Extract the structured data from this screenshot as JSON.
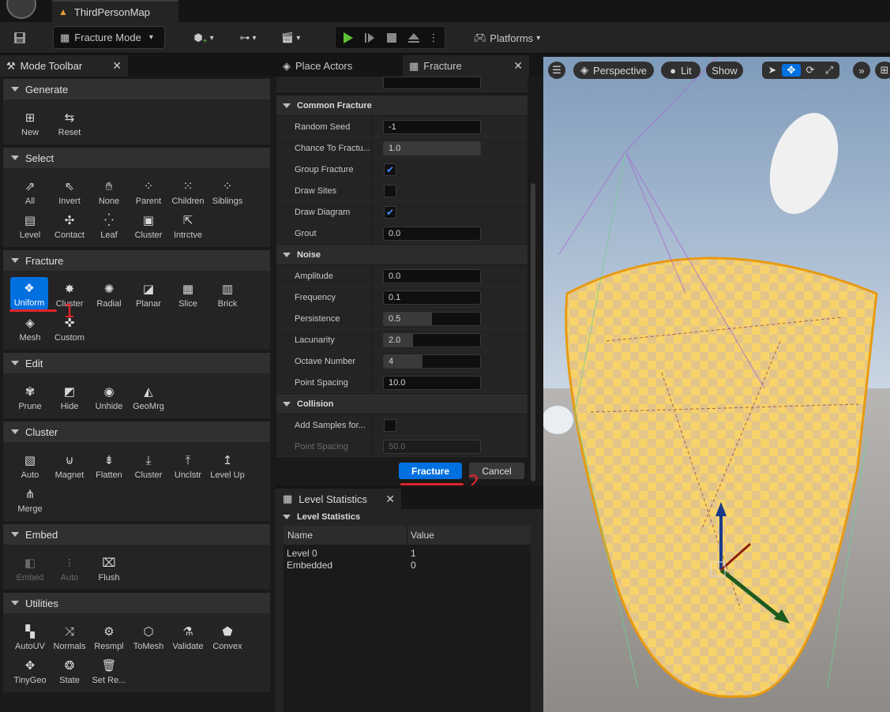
{
  "window": {
    "doc_tab": "ThirdPersonMap"
  },
  "toolbar": {
    "mode": "Fracture Mode",
    "platforms": "Platforms"
  },
  "mode_toolbar": {
    "tab": "Mode Toolbar",
    "sections": {
      "generate": {
        "title": "Generate",
        "tools": [
          "New",
          "Reset"
        ]
      },
      "select": {
        "title": "Select",
        "tools": [
          "All",
          "Invert",
          "None",
          "Parent",
          "Children",
          "Siblings",
          "Level",
          "Contact",
          "Leaf",
          "Cluster",
          "Intrctve"
        ]
      },
      "fracture": {
        "title": "Fracture",
        "tools": [
          "Uniform",
          "Cluster",
          "Radial",
          "Planar",
          "Slice",
          "Brick",
          "Mesh",
          "Custom"
        ]
      },
      "edit": {
        "title": "Edit",
        "tools": [
          "Prune",
          "Hide",
          "Unhide",
          "GeoMrg"
        ]
      },
      "cluster": {
        "title": "Cluster",
        "tools": [
          "Auto",
          "Magnet",
          "Flatten",
          "Cluster",
          "Unclstr",
          "Level Up",
          "Merge"
        ]
      },
      "embed": {
        "title": "Embed",
        "tools": [
          "Embed",
          "Auto",
          "Flush"
        ]
      },
      "utilities": {
        "title": "Utilities",
        "tools": [
          "AutoUV",
          "Normals",
          "Resmpl",
          "ToMesh",
          "Validate",
          "Convex",
          "TinyGeo",
          "State",
          "Set Re..."
        ]
      }
    }
  },
  "fracture_panel": {
    "tabs": [
      "Place Actors",
      "Fracture"
    ],
    "common_fracture": {
      "title": "Common Fracture",
      "random_seed": {
        "label": "Random Seed",
        "value": "-1"
      },
      "chance": {
        "label": "Chance To Fractu...",
        "value": "1.0",
        "level": 1.0
      },
      "group_fracture": {
        "label": "Group Fracture",
        "checked": true
      },
      "draw_sites": {
        "label": "Draw Sites",
        "checked": false
      },
      "draw_diagram": {
        "label": "Draw Diagram",
        "checked": true
      },
      "grout": {
        "label": "Grout",
        "value": "0.0"
      }
    },
    "noise": {
      "title": "Noise",
      "amplitude": {
        "label": "Amplitude",
        "value": "0.0"
      },
      "frequency": {
        "label": "Frequency",
        "value": "0.1"
      },
      "persistence": {
        "label": "Persistence",
        "value": "0.5",
        "level": 0.5
      },
      "lacunarity": {
        "label": "Lacunarity",
        "value": "2.0",
        "level": 0.3
      },
      "octave": {
        "label": "Octave Number",
        "value": "4",
        "level": 0.4
      },
      "point_spacing": {
        "label": "Point Spacing",
        "value": "10.0"
      }
    },
    "collision": {
      "title": "Collision",
      "add_samples": {
        "label": "Add Samples for...",
        "checked": false
      },
      "point_spacing": {
        "label": "Point Spacing",
        "value": "50.0"
      }
    },
    "fracture_button": "Fracture",
    "cancel_button": "Cancel"
  },
  "level_statistics": {
    "tab": "Level Statistics",
    "section": "Level Statistics",
    "columns": [
      "Name",
      "Value"
    ],
    "rows": [
      [
        "Level 0",
        "1"
      ],
      [
        "Embedded",
        "0"
      ]
    ]
  },
  "viewport": {
    "perspective": "Perspective",
    "lit": "Lit",
    "show": "Show"
  },
  "annotations": {
    "one": "1",
    "two": "2"
  },
  "colors": {
    "accent": "#0070e0",
    "annotation": "#e0242a",
    "check": "#3d8eff"
  }
}
